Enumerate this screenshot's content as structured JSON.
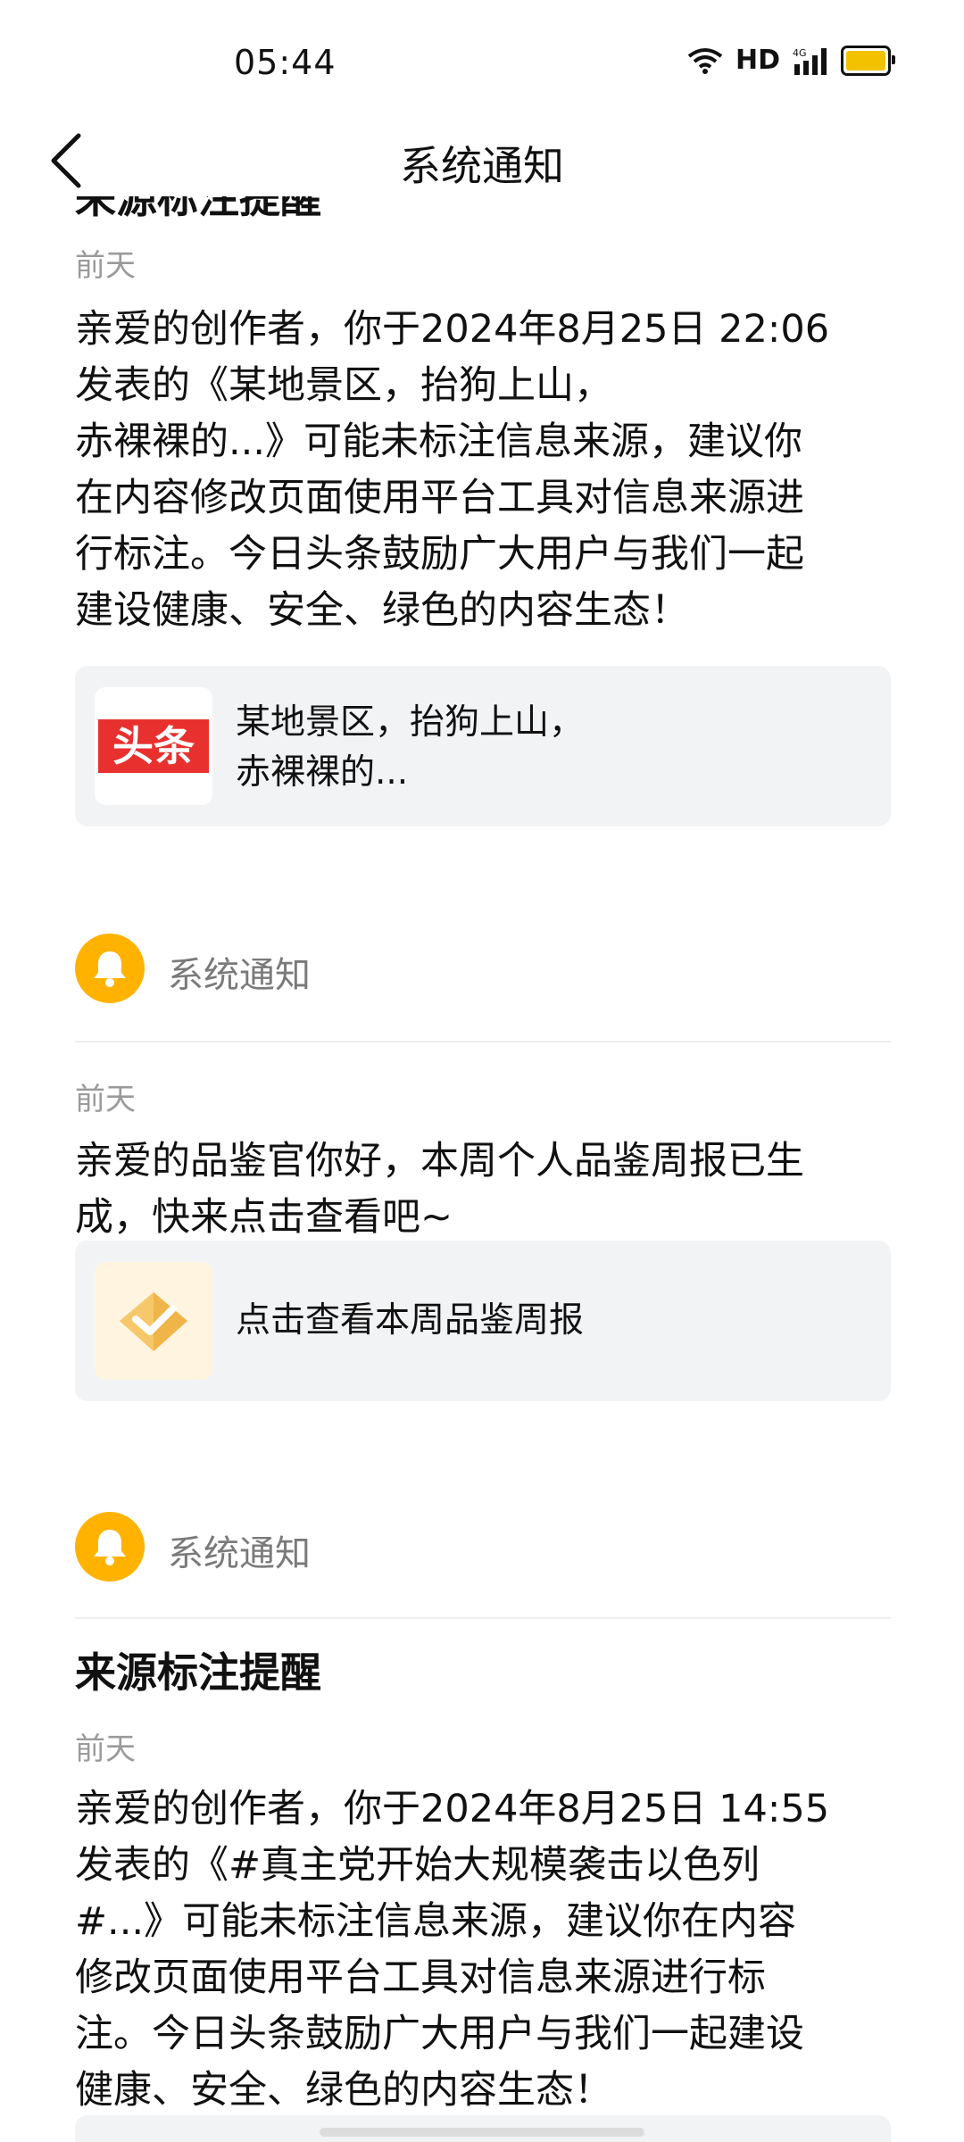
{
  "status_bar": {
    "time": "05:44",
    "network": "HD",
    "signal_label": "4G"
  },
  "nav": {
    "title": "系统通知"
  },
  "notices": [
    {
      "partial_title": "来源标注提醒",
      "date": "前天",
      "lines": [
        "亲爱的创作者，你于2024年8月25日 22:06",
        "发表的《某地景区，抬狗上山，",
        "赤裸裸的...》可能未标注信息来源，建议你",
        "在内容修改页面使用平台工具对信息来源进",
        "行标注。今日头条鼓励广大用户与我们一起",
        "建设健康、安全、绿色的内容生态！"
      ],
      "card": {
        "logo_text": "头条",
        "lines": [
          "某地景区，抬狗上山，",
          "赤裸裸的..."
        ]
      }
    },
    {
      "sender": "系统通知",
      "date": "前天",
      "lines": [
        "亲爱的品鉴官你好，本周个人品鉴周报已生",
        "成，快来点击查看吧~"
      ],
      "card": {
        "lines": [
          "点击查看本周品鉴周报"
        ]
      }
    },
    {
      "sender": "系统通知",
      "title": "来源标注提醒",
      "date": "前天",
      "lines": [
        "亲爱的创作者，你于2024年8月25日 14:55",
        "发表的《#真主党开始大规模袭击以色列",
        "#...》可能未标注信息来源，建议你在内容",
        "修改页面使用平台工具对信息来源进行标",
        "注。今日头条鼓励广大用户与我们一起建设",
        "健康、安全、绿色的内容生态！"
      ]
    }
  ],
  "colors": {
    "bell": "#ffb300",
    "card_bg": "#f2f3f5",
    "toutiao_red": "#e8312f",
    "secondary_text": "#9a9a9a"
  }
}
